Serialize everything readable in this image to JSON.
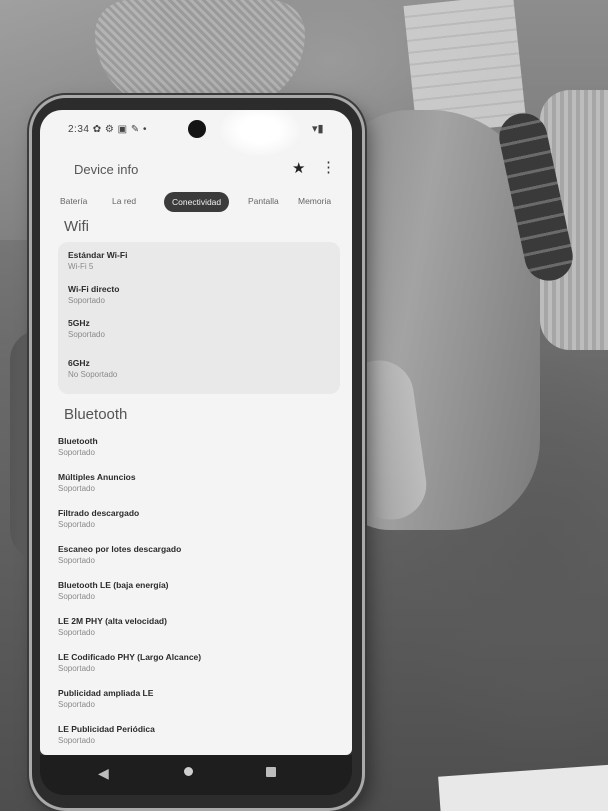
{
  "status": {
    "left": "2:34 ✿ ⚙ ▣ ✎ •",
    "right": "▾▮"
  },
  "app": {
    "title": "Device info",
    "star_icon": "★",
    "more_icon": "⋮"
  },
  "tabs": [
    {
      "label": "Batería"
    },
    {
      "label": "La red"
    },
    {
      "label": "Conectividad",
      "active": true
    },
    {
      "label": "Pantalla"
    },
    {
      "label": "Memoria"
    }
  ],
  "wifi": {
    "title": "Wifi",
    "items": [
      {
        "title": "Estándar Wi-Fi",
        "value": "Wi-Fi 5"
      },
      {
        "title": "Wi-Fi directo",
        "value": "Soportado"
      },
      {
        "title": "5GHz",
        "value": "Soportado"
      },
      {
        "title": "6GHz",
        "value": "No Soportado"
      }
    ]
  },
  "bluetooth": {
    "title": "Bluetooth",
    "items": [
      {
        "title": "Bluetooth",
        "value": "Soportado"
      },
      {
        "title": "Múltiples Anuncios",
        "value": "Soportado"
      },
      {
        "title": "Filtrado descargado",
        "value": "Soportado"
      },
      {
        "title": "Escaneo por lotes descargado",
        "value": "Soportado"
      },
      {
        "title": "Bluetooth LE (baja energía)",
        "value": "Soportado"
      },
      {
        "title": "LE 2M PHY (alta velocidad)",
        "value": "Soportado"
      },
      {
        "title": "LE Codificado PHY (Largo Alcance)",
        "value": "Soportado"
      },
      {
        "title": "Publicidad ampliada LE",
        "value": "Soportado"
      },
      {
        "title": "LE Publicidad Periódica",
        "value": "Soportado"
      }
    ]
  },
  "nav": {
    "back_icon": "◀"
  },
  "colors": {
    "screen_bg": "#f4f4f4",
    "active_tab": "#3b3b3b",
    "card_bg": "#e9e9e9"
  }
}
